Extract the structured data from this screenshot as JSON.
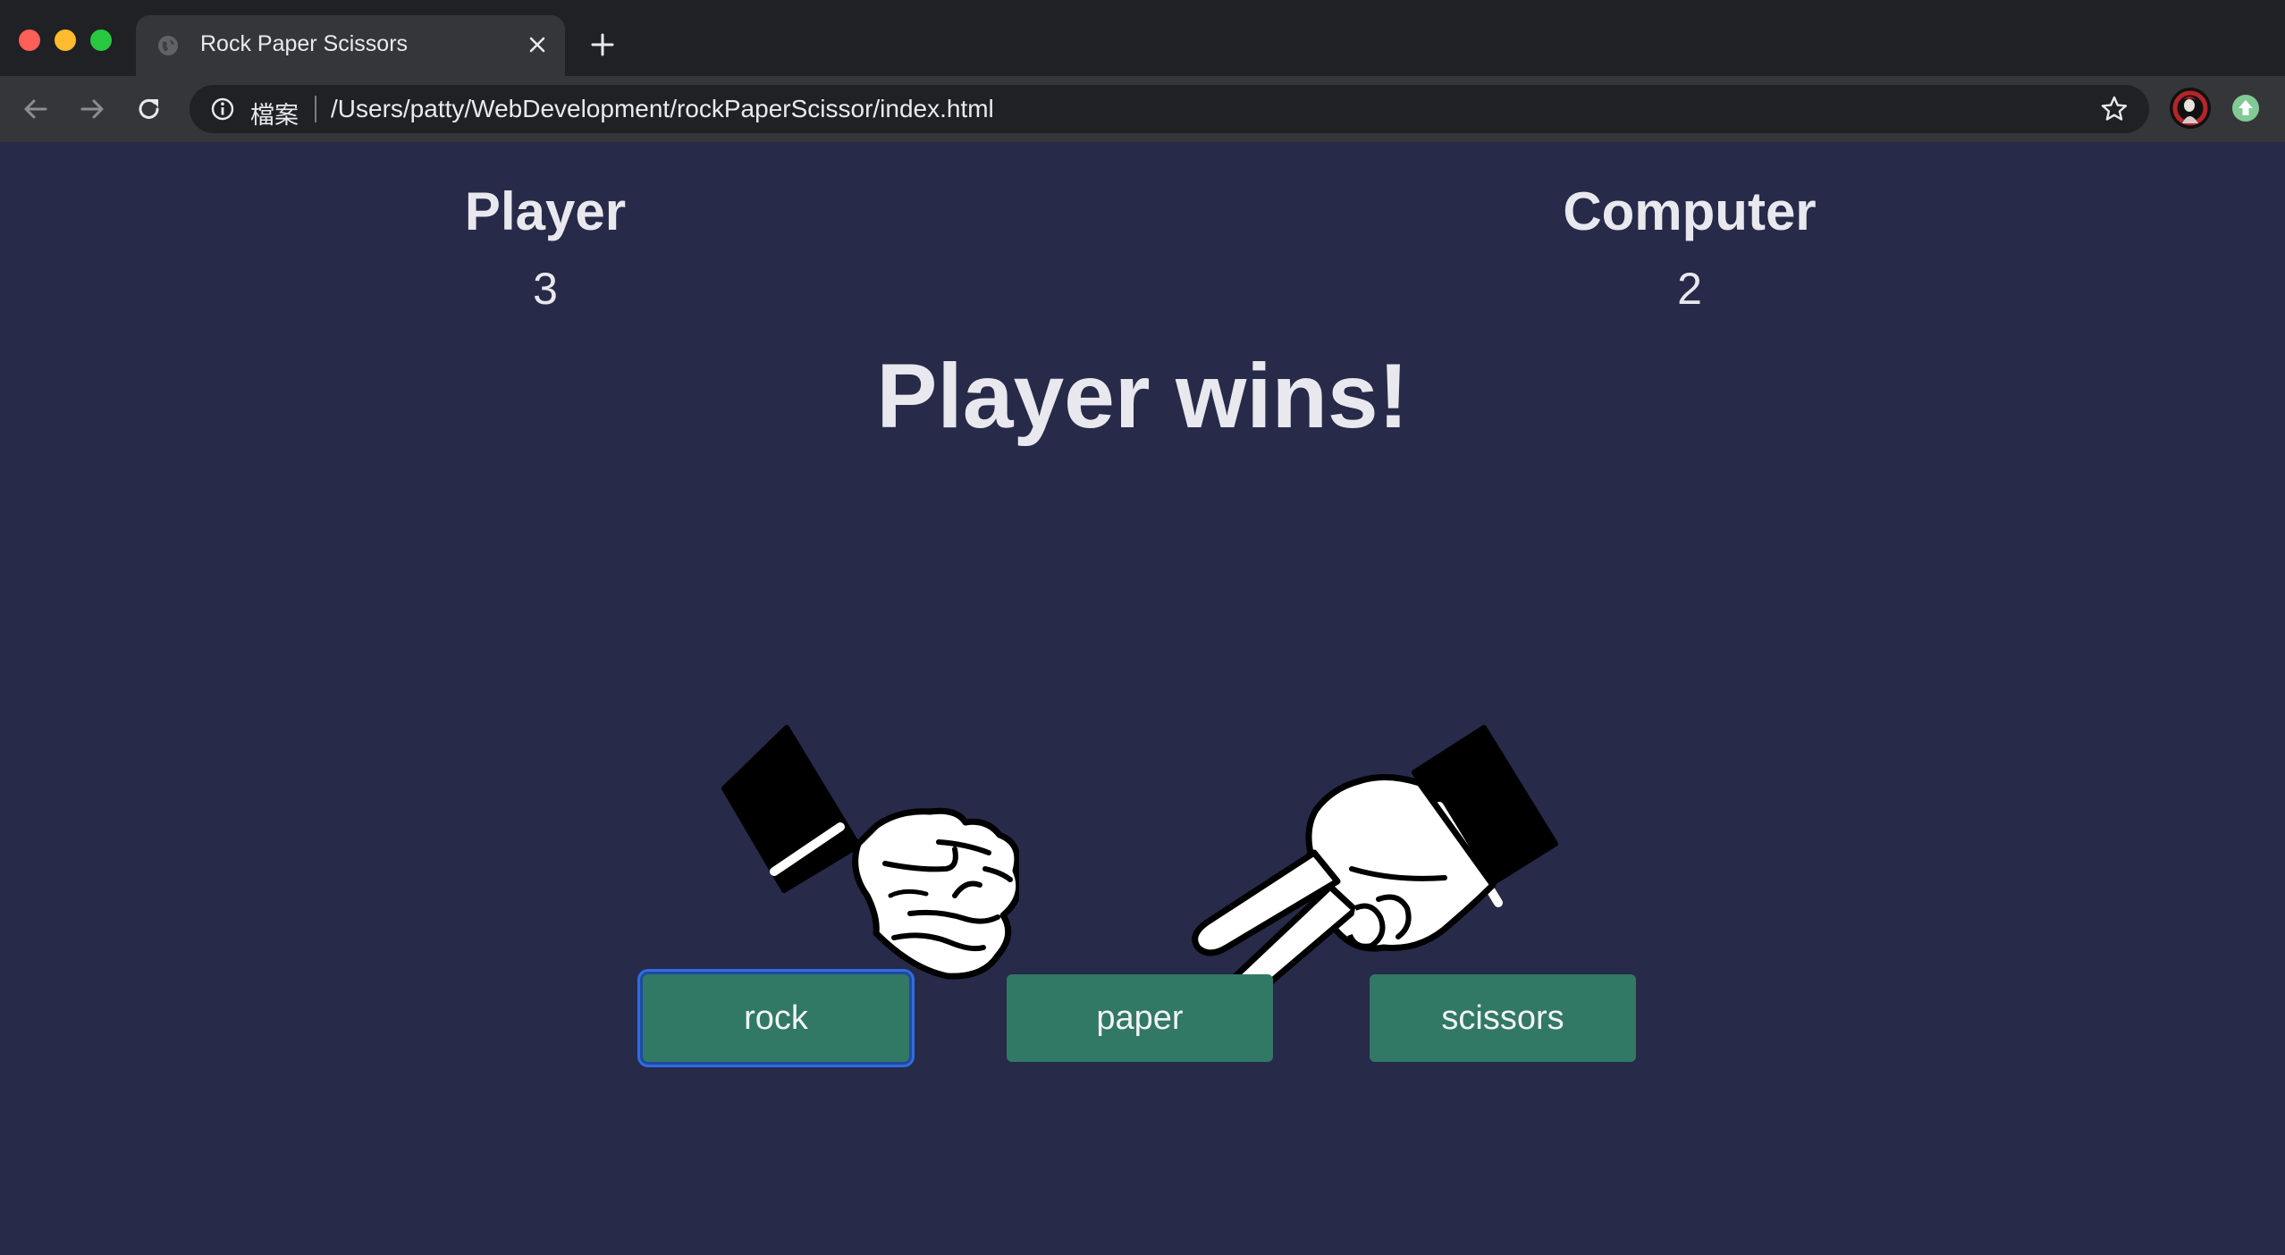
{
  "browser": {
    "tab_title": "Rock Paper Scissors",
    "scheme_label": "檔案",
    "url": "/Users/patty/WebDevelopment/rockPaperScissor/index.html",
    "icons": [
      "globe-icon",
      "close-icon",
      "plus-icon",
      "back-arrow-icon",
      "forward-arrow-icon",
      "reload-icon",
      "info-icon",
      "star-icon",
      "profile-avatar",
      "update-icon"
    ]
  },
  "game": {
    "player_label": "Player",
    "player_score": "3",
    "computer_label": "Computer",
    "computer_score": "2",
    "result": "Player wins!",
    "player_choice_icon": "rock-hand-icon",
    "computer_choice_icon": "scissors-hand-icon",
    "buttons": {
      "rock": "rock",
      "paper": "paper",
      "scissors": "scissors"
    },
    "focused_button": "rock"
  },
  "colors": {
    "page_background": "#272a48",
    "button_background": "#317865",
    "focus_ring": "#2f6ce0",
    "text": "#e8e8ee"
  }
}
